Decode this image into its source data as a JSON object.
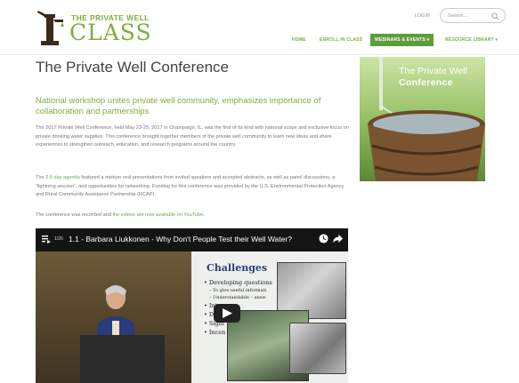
{
  "brand": {
    "line1": "THE PRIVATE WELL",
    "line2": "CLASS",
    "color": "#7fae3a"
  },
  "header": {
    "login_label": "LOGIN",
    "search_placeholder": "Search..."
  },
  "nav": {
    "items": [
      {
        "label": "HOME",
        "active": false
      },
      {
        "label": "ENROLL IN CLASS",
        "active": false
      },
      {
        "label": "WEBINARS & EVENTS ▾",
        "active": true
      },
      {
        "label": "RESOURCE LIBRARY ▾",
        "active": false
      }
    ],
    "active_color": "#5e9d3d"
  },
  "main": {
    "title": "The Private Well Conference",
    "subtitle": "National workshop unites private well community, emphasizes importance of collaboration and partnerships",
    "p1": "The 2017 Private Well Conference, held May 23-25, 2017 in Champaign, IL, was the first of its kind with national scope and exclusive focus on private drinking water supplies. This conference brought together members of the private well community to learn new ideas and share experiences to strengthen outreach, education, and research programs around the country.",
    "p2_link": "2.5 day agenda",
    "p2_pre": "The ",
    "p2_post": " featured a mixture oral presentations from invited speakers and accepted abstracts, as well as panel discussions, a “lightning session”, and opportunities for networking. Funding for this conference was provided by the U.S. Environmental Protection Agency and Rural Community Assistance Partnership (RCAP).",
    "p3_pre": "The conference was recorded and ",
    "p3_link": "the videos are now available on YouTube",
    "p3_post": "."
  },
  "video": {
    "count": "1/26",
    "title": "1.1 - Barbara Liukkonen - Why Don't People Test their Well Water?",
    "slide_title": "Challenges",
    "slide_lines": [
      {
        "kind": "b",
        "text": "• Developing questions"
      },
      {
        "kind": "s",
        "text": "– To give useful informati"
      },
      {
        "kind": "s",
        "text": "– Understandable – answ"
      },
      {
        "kind": "b",
        "text": "• Intern"
      },
      {
        "kind": "b",
        "text": "• Deali"
      },
      {
        "kind": "b",
        "text": "• Signi"
      },
      {
        "kind": "b",
        "text": "• Incen"
      }
    ]
  },
  "sidebar": {
    "line1": "The Private Well",
    "line2": "Conference"
  }
}
